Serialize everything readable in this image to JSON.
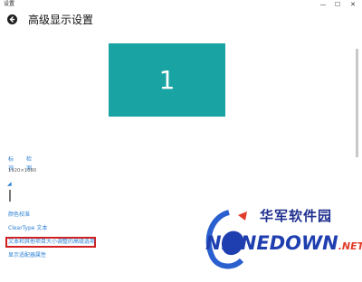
{
  "window": {
    "app_title": "设置",
    "controls": {
      "minimize": "—",
      "maximize": "☐",
      "close": "✕"
    }
  },
  "header": {
    "page_title": "高级显示设置"
  },
  "display": {
    "monitor_number": "1"
  },
  "actions": {
    "identify": "标识",
    "detect": "检测"
  },
  "resolution": {
    "text": "1920×1080"
  },
  "links": {
    "color_calibration": "颜色校准",
    "cleartype": "ClearType 文本",
    "advanced_sizing": "文本和其他项目大小调整的高级选项",
    "adapter_properties": "显示适配器属性"
  },
  "watermark": {
    "cn": "华军软件园",
    "en": "NLINEDOWN",
    "net": ".NET"
  },
  "colors": {
    "accent": "#2a7fd4",
    "monitor": "#1aa3a3",
    "highlight": "#d11f1f",
    "watermark_blue": "#1f3fb0",
    "watermark_red": "#e23b2a"
  }
}
